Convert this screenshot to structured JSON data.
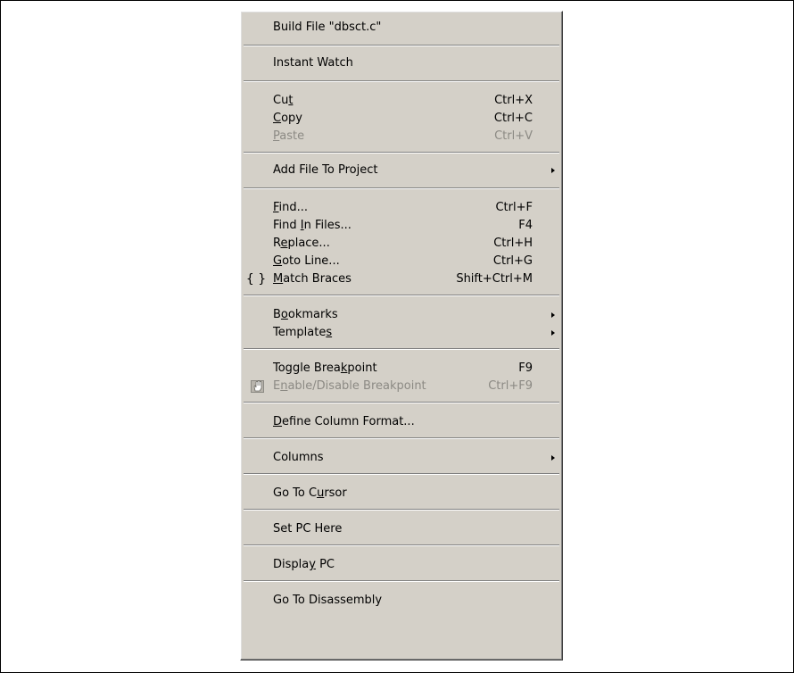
{
  "menu": {
    "items": [
      {
        "label": "Build File \"dbsct.c\""
      },
      {
        "label": "Instant Watch"
      },
      {
        "label": "Cut",
        "shortcut": "Ctrl+X",
        "mnemonic": "t"
      },
      {
        "label": "Copy",
        "shortcut": "Ctrl+C",
        "mnemonic": "C"
      },
      {
        "label": "Paste",
        "shortcut": "Ctrl+V",
        "mnemonic": "P",
        "disabled": true
      },
      {
        "label": "Add File To Project",
        "submenu": true
      },
      {
        "label": "Find...",
        "shortcut": "Ctrl+F",
        "mnemonic": "F"
      },
      {
        "label": "Find In Files...",
        "shortcut": "F4",
        "mnemonic": "I"
      },
      {
        "label": "Replace...",
        "shortcut": "Ctrl+H",
        "mnemonic": "e"
      },
      {
        "label": "Goto Line...",
        "shortcut": "Ctrl+G",
        "mnemonic": "G"
      },
      {
        "label": "Match Braces",
        "shortcut": "Shift+Ctrl+M",
        "mnemonic": "M",
        "icon": "{ }"
      },
      {
        "label": "Bookmarks",
        "submenu": true,
        "mnemonic": "o"
      },
      {
        "label": "Templates",
        "submenu": true,
        "mnemonic": "s"
      },
      {
        "label": "Toggle Breakpoint",
        "shortcut": "F9",
        "mnemonic": "k"
      },
      {
        "label": "Enable/Disable Breakpoint",
        "shortcut": "Ctrl+F9",
        "mnemonic": "n",
        "disabled": true,
        "icon": "hand-icon"
      },
      {
        "label": "Define Column Format...",
        "mnemonic": "D"
      },
      {
        "label": "Columns",
        "submenu": true
      },
      {
        "label": "Go To Cursor",
        "mnemonic": "u"
      },
      {
        "label": "Set PC Here"
      },
      {
        "label": "Display PC",
        "mnemonic": "y"
      },
      {
        "label": "Go To Disassembly"
      }
    ]
  },
  "colors": {
    "menu_bg": "#d4d0c8",
    "disabled_text": "#8c8a84",
    "separator_dark": "#808080"
  }
}
